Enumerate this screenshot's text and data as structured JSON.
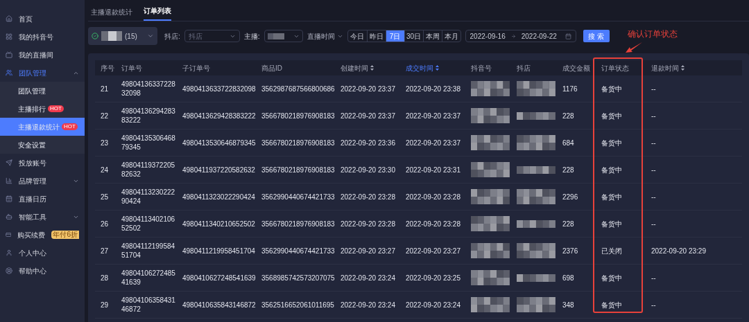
{
  "sidebar": {
    "items": [
      {
        "label": "首页",
        "selected": false
      },
      {
        "label": "我的抖音号",
        "selected": false
      },
      {
        "label": "我的直播间",
        "selected": false
      },
      {
        "label": "团队管理",
        "selected": false,
        "active": true,
        "expanded": true,
        "children": [
          {
            "label": "团队管理",
            "selected": false
          },
          {
            "label": "主播排行",
            "badge": "HOT",
            "selected": false
          },
          {
            "label": "主播退款统计",
            "badge": "HOT",
            "selected": true
          },
          {
            "label": "安全设置",
            "selected": false
          }
        ]
      },
      {
        "label": "投放账号",
        "selected": false
      },
      {
        "label": "品牌管理",
        "selected": false,
        "expanded": false
      },
      {
        "label": "直播日历",
        "selected": false
      },
      {
        "label": "智能工具",
        "selected": false,
        "expanded": false
      },
      {
        "label": "购买续费",
        "selected": false,
        "promo": "年付6折"
      },
      {
        "label": "个人中心",
        "selected": false
      },
      {
        "label": "帮助中心",
        "selected": false
      }
    ]
  },
  "tabs": [
    {
      "label": "主播退款统计",
      "selected": false
    },
    {
      "label": "订单列表",
      "selected": true
    }
  ],
  "filters": {
    "account": {
      "count": "(15)"
    },
    "shop": {
      "label": "抖店:",
      "placeholder": "抖店"
    },
    "anchor": {
      "label": "主播:"
    },
    "time_type": {
      "label": "直播时间"
    },
    "ranges": [
      {
        "label": "今日",
        "selected": false
      },
      {
        "label": "昨日",
        "selected": false
      },
      {
        "label": "7日",
        "selected": true
      },
      {
        "label": "30日",
        "selected": false
      },
      {
        "label": "本周",
        "selected": false
      },
      {
        "label": "本月",
        "selected": false
      }
    ],
    "date_from": "2022-09-16",
    "date_to": "2022-09-22",
    "search": "搜 索"
  },
  "annotation": "确认订单状态",
  "table": {
    "columns": [
      {
        "label": "序号",
        "sortable": false,
        "active": false
      },
      {
        "label": "订单号",
        "sortable": false,
        "active": false
      },
      {
        "label": "子订单号",
        "sortable": false,
        "active": false
      },
      {
        "label": "商品ID",
        "sortable": false,
        "active": false
      },
      {
        "label": "创建时间",
        "sortable": true,
        "active": false
      },
      {
        "label": "成交时间",
        "sortable": true,
        "active": true
      },
      {
        "label": "抖音号",
        "sortable": false,
        "active": false
      },
      {
        "label": "抖店",
        "sortable": false,
        "active": false
      },
      {
        "label": "成交金额",
        "sortable": false,
        "active": false
      },
      {
        "label": "订单状态",
        "sortable": false,
        "active": false
      },
      {
        "label": "退款时间",
        "sortable": true,
        "active": false
      }
    ],
    "rows": [
      {
        "no": "21",
        "order": "4980413633722832098",
        "sub_order": "4980413633722832098",
        "product": "3562987687566800686",
        "created": "2022-09-20 23:37",
        "paid": "2022-09-20 23:38",
        "amount": "1176",
        "status": "备货中",
        "refund": "--"
      },
      {
        "no": "22",
        "order": "4980413629428383222",
        "sub_order": "4980413629428383222",
        "product": "3566780218976908183",
        "created": "2022-09-20 23:37",
        "paid": "2022-09-20 23:37",
        "amount": "228",
        "status": "备货中",
        "refund": "--"
      },
      {
        "no": "23",
        "order": "4980413530646879345",
        "sub_order": "4980413530646879345",
        "product": "3566780218976908183",
        "created": "2022-09-20 23:36",
        "paid": "2022-09-20 23:37",
        "amount": "684",
        "status": "备货中",
        "refund": "--"
      },
      {
        "no": "24",
        "order": "4980411937220582632",
        "sub_order": "4980411937220582632",
        "product": "3566780218976908183",
        "created": "2022-09-20 23:30",
        "paid": "2022-09-20 23:31",
        "amount": "228",
        "status": "备货中",
        "refund": "--"
      },
      {
        "no": "25",
        "order": "4980411323022290424",
        "sub_order": "4980411323022290424",
        "product": "3562990440674421733",
        "created": "2022-09-20 23:28",
        "paid": "2022-09-20 23:28",
        "amount": "2296",
        "status": "备货中",
        "refund": "--"
      },
      {
        "no": "26",
        "order": "4980411340210652502",
        "sub_order": "4980411340210652502",
        "product": "3566780218976908183",
        "created": "2022-09-20 23:28",
        "paid": "2022-09-20 23:28",
        "amount": "228",
        "status": "备货中",
        "refund": "--"
      },
      {
        "no": "27",
        "order": "4980411219958451704",
        "sub_order": "4980411219958451704",
        "product": "3562990440674421733",
        "created": "2022-09-20 23:27",
        "paid": "2022-09-20 23:27",
        "amount": "2376",
        "status": "已关闭",
        "refund": "2022-09-20 23:29"
      },
      {
        "no": "28",
        "order": "4980410627248541639",
        "sub_order": "4980410627248541639",
        "product": "3568985742573207075",
        "created": "2022-09-20 23:24",
        "paid": "2022-09-20 23:25",
        "amount": "698",
        "status": "备货中",
        "refund": "--"
      },
      {
        "no": "29",
        "order": "4980410635843146872",
        "sub_order": "4980410635843146872",
        "product": "3562516652061011695",
        "created": "2022-09-20 23:24",
        "paid": "2022-09-20 23:24",
        "amount": "348",
        "status": "备货中",
        "refund": "--"
      }
    ]
  }
}
